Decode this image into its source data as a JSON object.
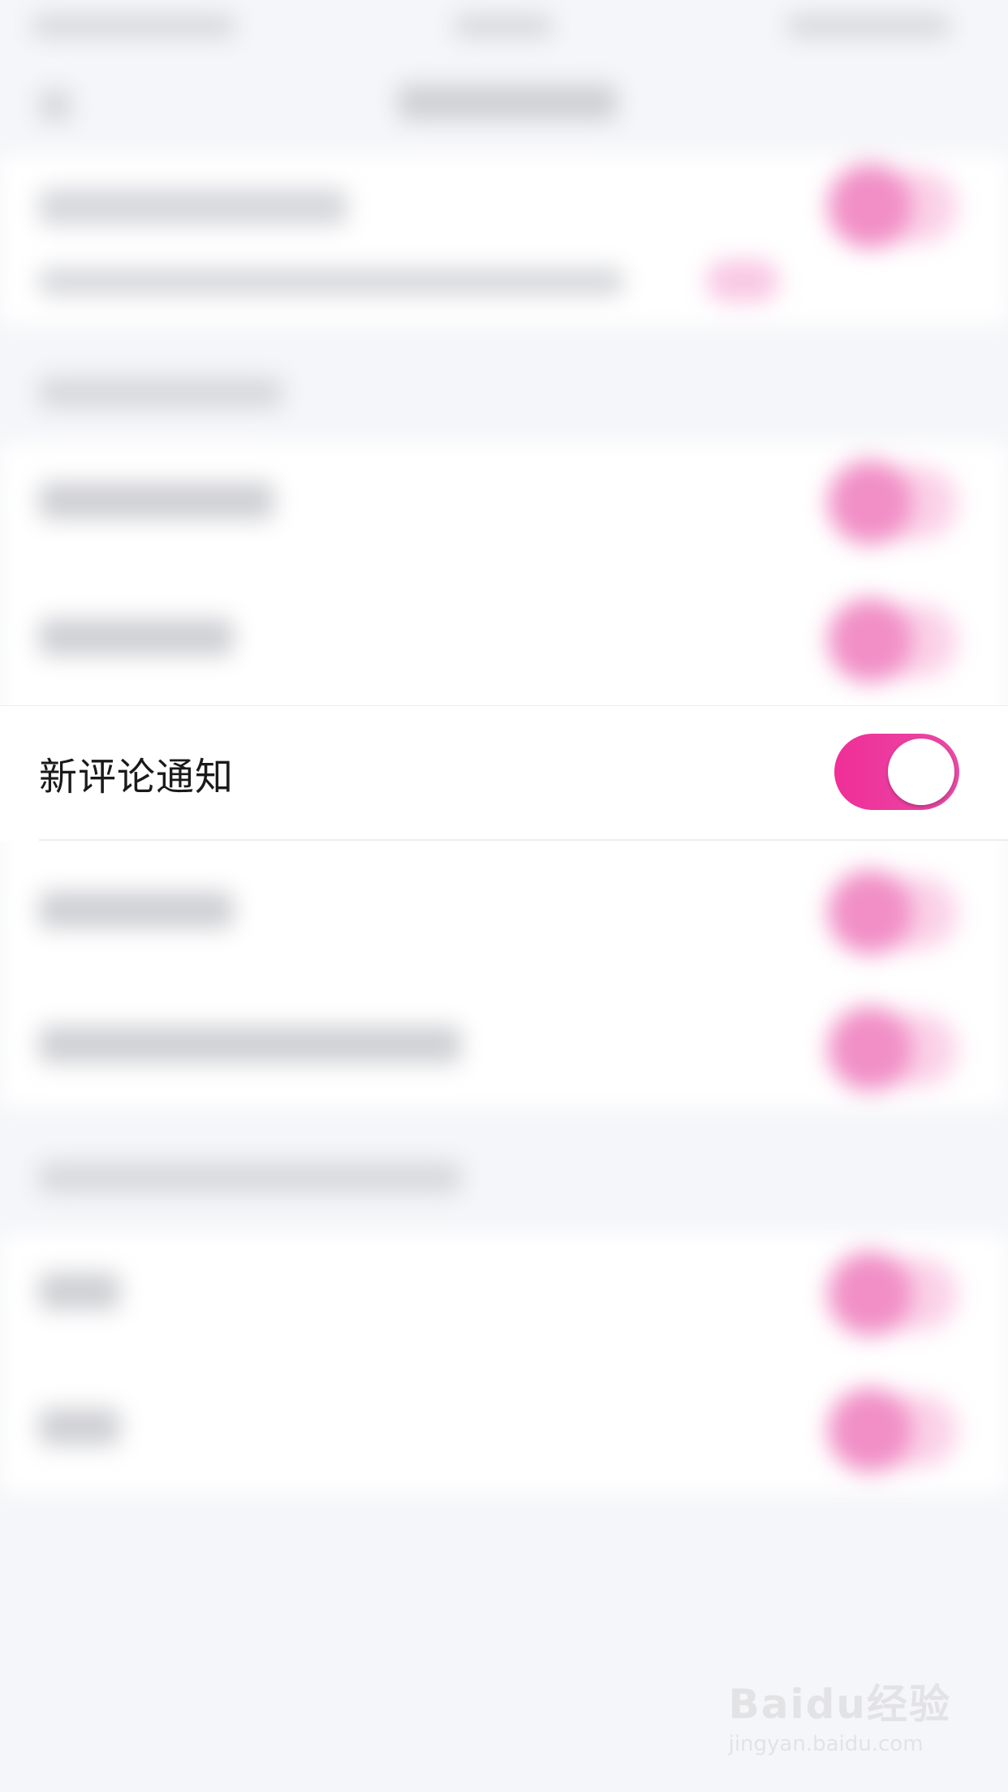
{
  "settings": {
    "focused_row": {
      "label": "新评论通知",
      "toggle_on": true
    }
  },
  "colors": {
    "accent": "#f0359c",
    "background": "#f5f6f9"
  },
  "watermark": {
    "logo_text": "Baidu经验",
    "url_text": "jingyan.baidu.com"
  }
}
